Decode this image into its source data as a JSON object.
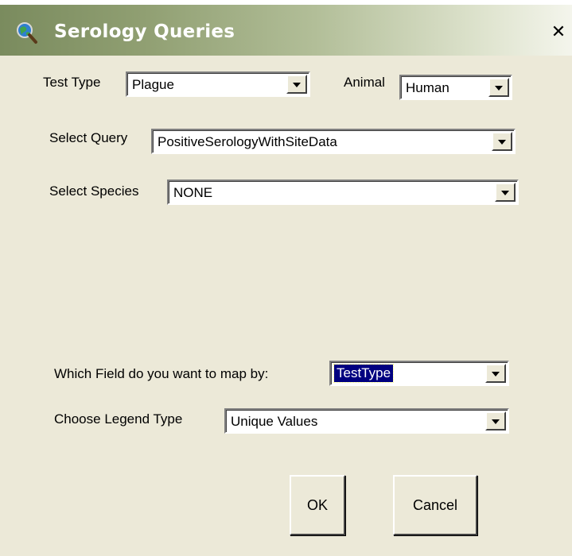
{
  "window": {
    "title": "Serology Queries",
    "close_label": "✕"
  },
  "test_type": {
    "label": "Test Type",
    "value": "Plague"
  },
  "animal": {
    "label": "Animal",
    "value": "Human"
  },
  "query": {
    "label": "Select Query",
    "value": "PositiveSerologyWithSiteData"
  },
  "species": {
    "label": "Select Species",
    "value": "NONE"
  },
  "map_field": {
    "label": "Which Field do you want to map by:",
    "value": "TestType"
  },
  "legend": {
    "label": "Choose Legend Type",
    "value": "Unique Values"
  },
  "buttons": {
    "ok": "OK",
    "cancel": "Cancel"
  },
  "colors": {
    "selection": "#000080",
    "face": "#ece9d8"
  },
  "icons": {
    "app": "magnifier-globe-icon",
    "dropdown": "chevron-down-icon",
    "close": "close-icon"
  }
}
